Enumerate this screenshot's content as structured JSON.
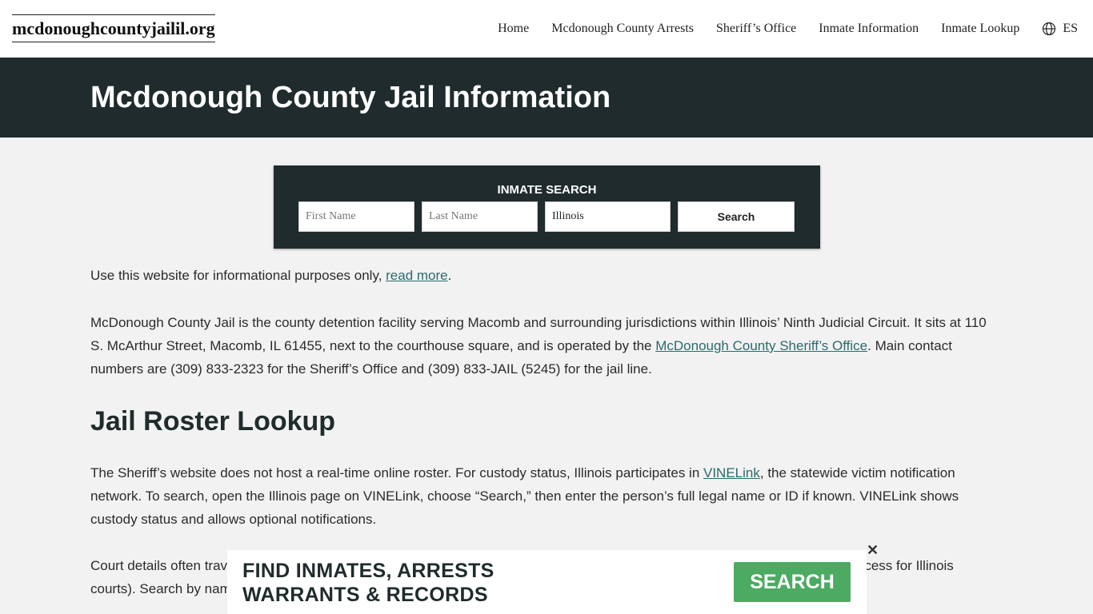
{
  "header": {
    "logo": "mcdonoughcountyjailil.org",
    "nav": [
      "Home",
      "Mcdonough County Arrests",
      "Sheriff’s Office",
      "Inmate Information",
      "Inmate Lookup"
    ],
    "lang_label": "ES",
    "lang_icon": "globe-icon"
  },
  "hero": {
    "title": "Mcdonough County Jail Information"
  },
  "search": {
    "title": "INMATE SEARCH",
    "first_placeholder": "First Name",
    "last_placeholder": "Last Name",
    "state_value": "Illinois",
    "button": "Search"
  },
  "content": {
    "disclaimer_text": "Use this website for informational purposes only, ",
    "disclaimer_link": "read more",
    "disclaimer_end": ".",
    "intro_a": "McDonough County Jail is the county detention facility serving Macomb and surrounding jurisdictions within Illinois’ Ninth Judicial Circuit. It sits at 110 S. McArthur Street, Macomb, IL 61455, next to the courthouse square, and is operated by the ",
    "intro_link": "McDonough County Sheriff’s Office",
    "intro_b": ". Main contact numbers are (309) 833-2323 for the Sheriff’s Office and (309) 833-JAIL (5245) for the jail line.",
    "roster_heading": "Jail Roster Lookup",
    "roster_a": "The Sheriff’s website does not host a real-time online roster. For custody status, Illinois participates in ",
    "roster_link": "VINELink",
    "roster_b": ", the statewide victim notification network. To search, open the Illinois page on VINELink, choose “Search,” then enter the person’s full legal name or ID if known. VINELink shows custody status and allows optional notifications.",
    "court_text": "Court details often travel alongside custody records. McDonough County publishes the person’s court entries on Judici (public access for Illinois courts). Search by name or case number to find charges and information. Have the person’s name and date of birth ready."
  },
  "ad": {
    "line1": "FIND INMATES, ARRESTS",
    "line2": "WARRANTS & RECORDS",
    "button": "SEARCH",
    "close": "✕",
    "button_color": "#4caa62"
  },
  "colors": {
    "dark": "#1f2b2c",
    "link": "#2c6b6b",
    "background": "#f2f2f2"
  }
}
